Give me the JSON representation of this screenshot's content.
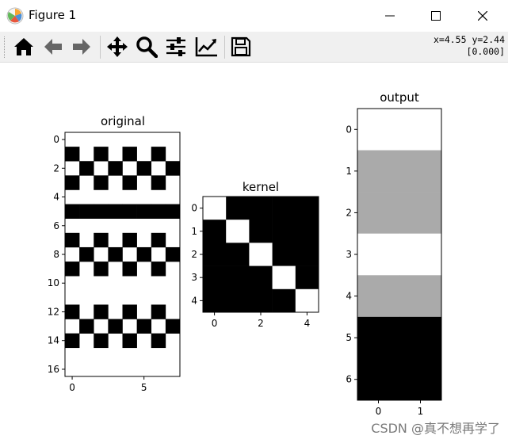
{
  "window": {
    "title": "Figure 1"
  },
  "toolbar": {
    "buttons": [
      {
        "name": "home-button",
        "icon": "home-icon"
      },
      {
        "name": "back-button",
        "icon": "arrow-left-icon"
      },
      {
        "name": "forward-button",
        "icon": "arrow-right-icon"
      },
      {
        "name": "pan-button",
        "icon": "move-icon"
      },
      {
        "name": "zoom-button",
        "icon": "magnifier-icon"
      },
      {
        "name": "subplots-button",
        "icon": "sliders-icon"
      },
      {
        "name": "edit-axes-button",
        "icon": "line-chart-icon"
      },
      {
        "name": "save-button",
        "icon": "floppy-disk-icon"
      }
    ],
    "coords_line1": "x=4.55 y=2.44",
    "coords_line2": "[0.000]"
  },
  "watermark": "CSDN @真不想再学了",
  "chart_data": [
    {
      "type": "heatmap",
      "title": "original",
      "rows": 17,
      "cols": 8,
      "xticks": [
        0,
        5
      ],
      "yticks": [
        0,
        2,
        4,
        6,
        8,
        10,
        12,
        14,
        16
      ],
      "cmap": "gray",
      "black_cells": [
        [
          1,
          0
        ],
        [
          1,
          2
        ],
        [
          1,
          4
        ],
        [
          1,
          6
        ],
        [
          2,
          1
        ],
        [
          2,
          3
        ],
        [
          2,
          5
        ],
        [
          2,
          7
        ],
        [
          3,
          0
        ],
        [
          3,
          2
        ],
        [
          3,
          4
        ],
        [
          3,
          6
        ],
        [
          5,
          0
        ],
        [
          5,
          1
        ],
        [
          5,
          2
        ],
        [
          5,
          3
        ],
        [
          5,
          4
        ],
        [
          5,
          5
        ],
        [
          5,
          6
        ],
        [
          5,
          7
        ],
        [
          7,
          0
        ],
        [
          7,
          2
        ],
        [
          7,
          4
        ],
        [
          7,
          6
        ],
        [
          8,
          1
        ],
        [
          8,
          3
        ],
        [
          8,
          5
        ],
        [
          8,
          7
        ],
        [
          9,
          0
        ],
        [
          9,
          2
        ],
        [
          9,
          4
        ],
        [
          9,
          6
        ],
        [
          12,
          0
        ],
        [
          12,
          2
        ],
        [
          12,
          4
        ],
        [
          12,
          6
        ],
        [
          13,
          1
        ],
        [
          13,
          3
        ],
        [
          13,
          5
        ],
        [
          13,
          7
        ],
        [
          14,
          0
        ],
        [
          14,
          2
        ],
        [
          14,
          4
        ],
        [
          14,
          6
        ]
      ]
    },
    {
      "type": "heatmap",
      "title": "kernel",
      "rows": 5,
      "cols": 5,
      "xticks": [
        0,
        2,
        4
      ],
      "yticks": [
        0,
        1,
        2,
        3,
        4
      ],
      "cmap": "gray",
      "values": [
        [
          1,
          0,
          0,
          0,
          0
        ],
        [
          0,
          1,
          0,
          0,
          0
        ],
        [
          0,
          0,
          1,
          0,
          0
        ],
        [
          0,
          0,
          0,
          1,
          0
        ],
        [
          0,
          0,
          0,
          0,
          1
        ]
      ]
    },
    {
      "type": "heatmap",
      "title": "output",
      "rows": 7,
      "cols": 2,
      "xticks": [
        0,
        1
      ],
      "yticks": [
        0,
        1,
        2,
        3,
        4,
        5,
        6
      ],
      "cmap": "gray",
      "row_shades": [
        "#ffffff",
        "#aaaaaa",
        "#aaaaaa",
        "#ffffff",
        "#aaaaaa",
        "#000000",
        "#000000"
      ]
    }
  ]
}
